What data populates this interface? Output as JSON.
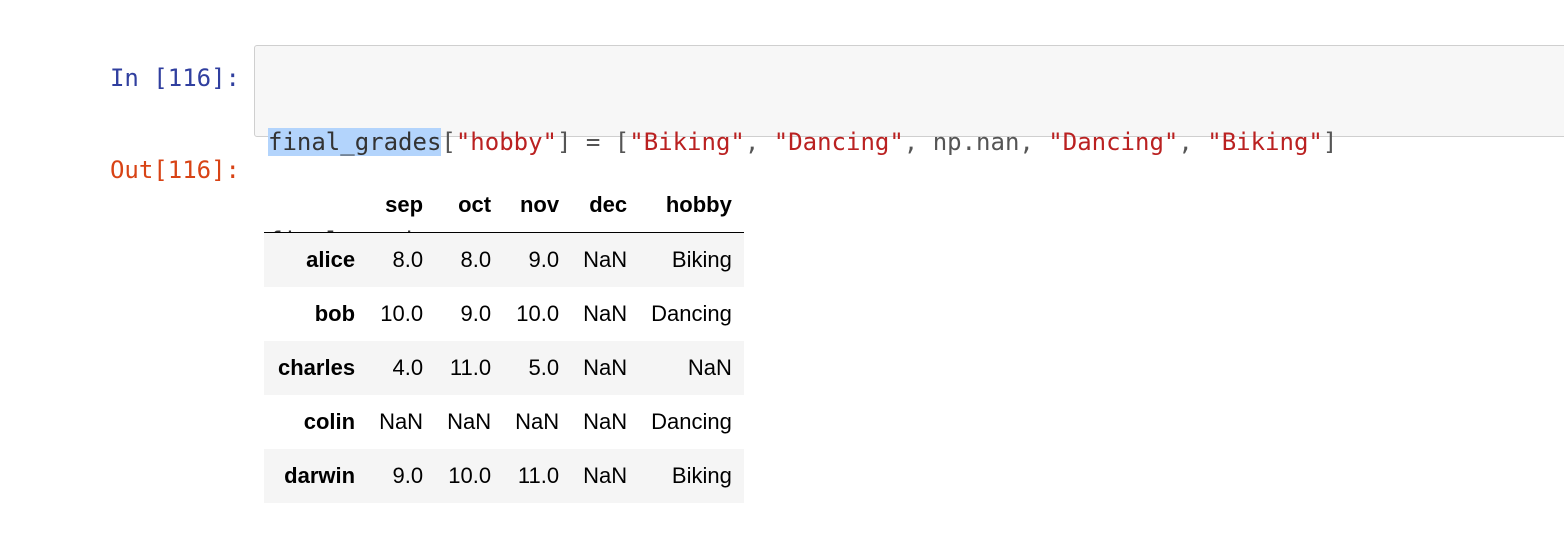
{
  "input_prompt": "In [116]:",
  "output_prompt": "Out[116]:",
  "code": {
    "line1": {
      "var_highlighted": "final_grades",
      "open": "[",
      "key": "\"hobby\"",
      "close_assign": "] = [",
      "s1": "\"Biking\"",
      "sep1": ", ",
      "s2": "\"Dancing\"",
      "mid": ", np.nan, ",
      "s3": "\"Dancing\"",
      "sep2": ", ",
      "s4": "\"Biking\"",
      "end": "]"
    },
    "line2": "final_grades"
  },
  "table": {
    "columns": [
      "",
      "sep",
      "oct",
      "nov",
      "dec",
      "hobby"
    ],
    "rows": [
      {
        "index": "alice",
        "cells": [
          "8.0",
          "8.0",
          "9.0",
          "NaN",
          "Biking"
        ]
      },
      {
        "index": "bob",
        "cells": [
          "10.0",
          "9.0",
          "10.0",
          "NaN",
          "Dancing"
        ]
      },
      {
        "index": "charles",
        "cells": [
          "4.0",
          "11.0",
          "5.0",
          "NaN",
          "NaN"
        ]
      },
      {
        "index": "colin",
        "cells": [
          "NaN",
          "NaN",
          "NaN",
          "NaN",
          "Dancing"
        ]
      },
      {
        "index": "darwin",
        "cells": [
          "9.0",
          "10.0",
          "11.0",
          "NaN",
          "Biking"
        ]
      }
    ]
  },
  "colors": {
    "input_prompt": "#303F9F",
    "output_prompt": "#D84315",
    "string": "#BA2121",
    "selection": "#b3d4fc",
    "stripe": "#f5f5f5"
  }
}
